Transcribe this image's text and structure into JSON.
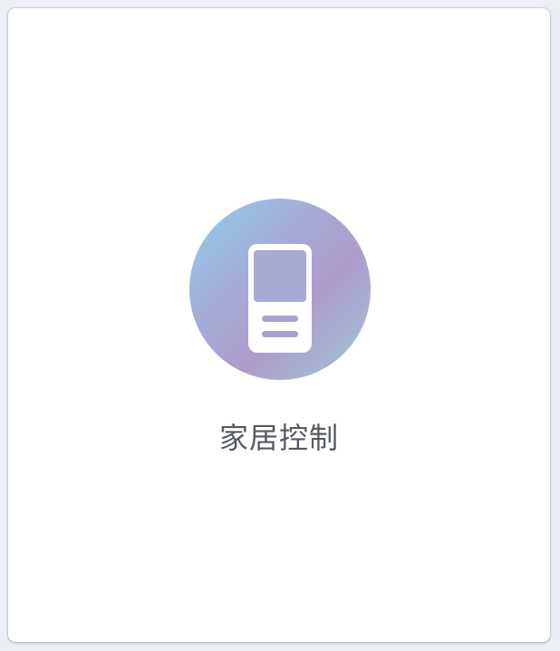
{
  "tile": {
    "label": "家居控制",
    "icon": "device-remote-icon",
    "gradient_colors": [
      "#8ecfee",
      "#a6aad6",
      "#ae9bcb",
      "#9ccbd6"
    ],
    "icon_color": "#ffffff",
    "label_color": "#555a60"
  }
}
